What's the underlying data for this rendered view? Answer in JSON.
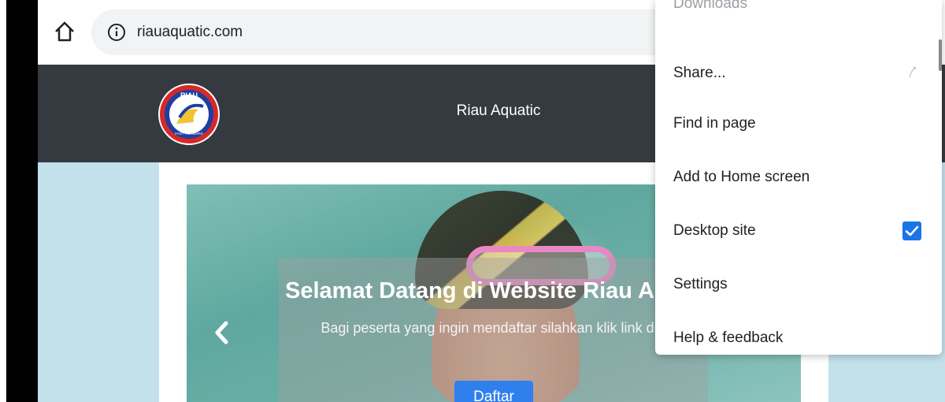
{
  "browser": {
    "url": "riauaquatic.com"
  },
  "site": {
    "brand_title": "Riau Aquatic",
    "logo": {
      "text_top": "RIAU",
      "text_mid": "AQUATIC",
      "text_bottom": "FAST FORWARD"
    },
    "carousel": {
      "title": "Selamat Datang di Website Riau Aquatic",
      "description": "Bagi peserta yang ingin mendaftar silahkan klik link di bawah ini.",
      "button_label": "Daftar"
    }
  },
  "menu": {
    "items": [
      {
        "label": "Downloads"
      },
      {
        "label": "Share..."
      },
      {
        "label": "Find in page"
      },
      {
        "label": "Add to Home screen"
      },
      {
        "label": "Desktop site",
        "checked": true
      },
      {
        "label": "Settings"
      },
      {
        "label": "Help & feedback"
      }
    ]
  },
  "colors": {
    "header": "#343a40",
    "page_background": "#c2e1ea",
    "button": "#2f80ed",
    "checkbox": "#1a73e8"
  },
  "icons": [
    "home-icon",
    "info-icon",
    "share-icon",
    "chevron-left-icon",
    "checkmark-icon"
  ]
}
